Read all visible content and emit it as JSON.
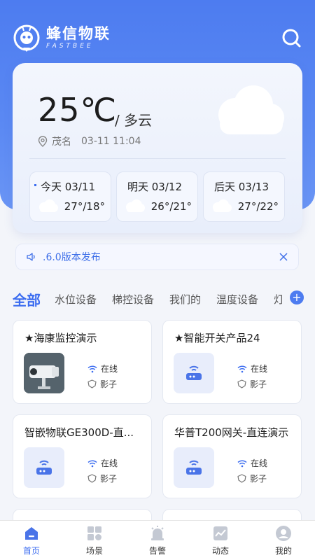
{
  "brand": {
    "name": "蜂信物联",
    "sub": "FASTBEE"
  },
  "weather": {
    "temperature": "25℃",
    "condition": "/ 多云",
    "location": "茂名",
    "datetime": "03-11 11:04",
    "forecast": [
      {
        "day": "今天 03/11",
        "range": "27°/18°"
      },
      {
        "day": "明天 03/12",
        "range": "26°/21°"
      },
      {
        "day": "后天 03/13",
        "range": "27°/22°"
      }
    ]
  },
  "notice": {
    "text": ".6.0版本发布"
  },
  "tabs": [
    "全部",
    "水位设备",
    "梯控设备",
    "我们的",
    "温度设备",
    "灯"
  ],
  "devices": [
    {
      "name": "★海康监控演示",
      "online": "在线",
      "shadow": "影子"
    },
    {
      "name": "★智能开关产品24",
      "online": "在线",
      "shadow": "影子"
    },
    {
      "name": "智嵌物联GE300D-直...",
      "online": "在线",
      "shadow": "影子"
    },
    {
      "name": "华普T200网关-直连演示",
      "online": "在线",
      "shadow": "影子"
    }
  ],
  "nav": [
    {
      "label": "首页",
      "icon": "home-icon"
    },
    {
      "label": "场景",
      "icon": "grid-icon"
    },
    {
      "label": "告警",
      "icon": "alarm-icon"
    },
    {
      "label": "动态",
      "icon": "chart-icon"
    },
    {
      "label": "我的",
      "icon": "user-icon"
    }
  ],
  "colors": {
    "primary": "#3b6cf0",
    "hero": "#4d7cf0",
    "online": "#3b6cf0"
  }
}
